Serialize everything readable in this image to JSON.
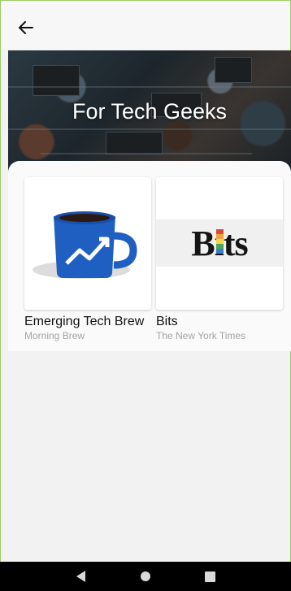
{
  "header": {
    "back_icon": "arrow-left-icon"
  },
  "hero": {
    "title": "For Tech Geeks"
  },
  "cards": [
    {
      "title": "Emerging Tech Brew",
      "subtitle": "Morning Brew",
      "thumb_icon": "mug-chart-icon"
    },
    {
      "title": "Bits",
      "subtitle": "The New York Times",
      "thumb_logo_text": "Bits"
    }
  ],
  "system_nav": {
    "back_icon": "nav-back-icon",
    "home_icon": "nav-home-icon",
    "recents_icon": "nav-recents-icon"
  },
  "colors": {
    "accent_border": "#9ccc65",
    "mug_blue": "#1f5fc2"
  }
}
